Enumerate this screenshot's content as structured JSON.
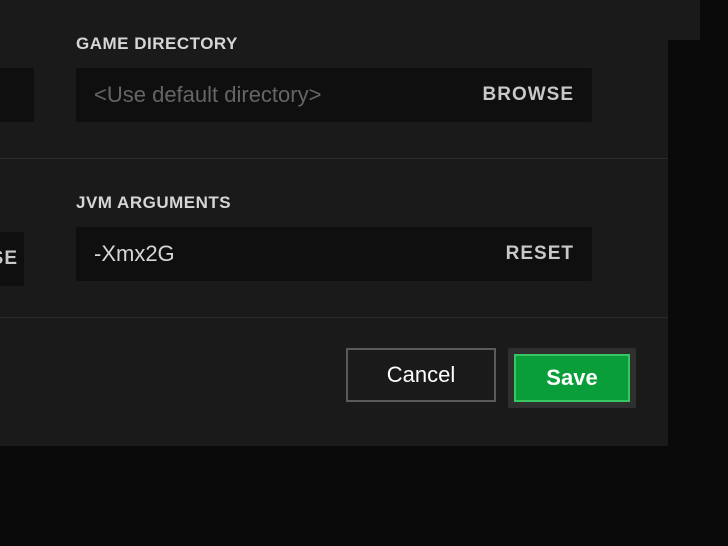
{
  "directory": {
    "label": "GAME DIRECTORY",
    "placeholder": "<Use default directory>",
    "browse_label": "BROWSE"
  },
  "jvm": {
    "label": "JVM ARGUMENTS",
    "value": "-Xmx2G",
    "reset_label": "RESET"
  },
  "actions": {
    "cancel": "Cancel",
    "save": "Save"
  },
  "fragments": {
    "left_mid": "SE"
  },
  "colors": {
    "accent": "#0a9e3a",
    "accent_border": "#37c762",
    "panel": "#1a1a1a",
    "input_bg": "#0f0f0f"
  }
}
